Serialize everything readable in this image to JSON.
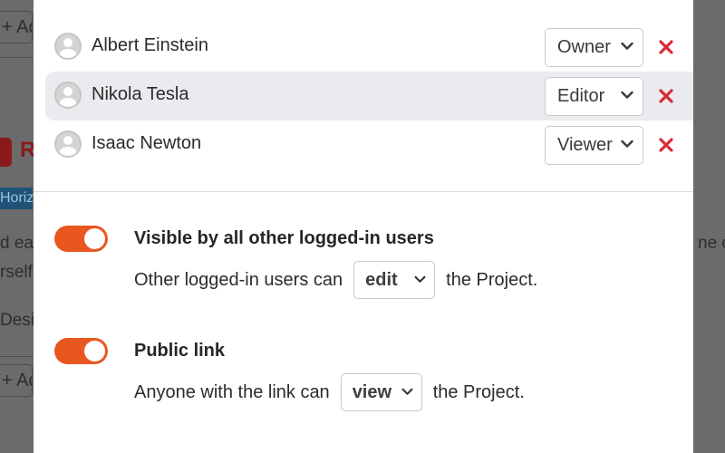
{
  "background": {
    "add_label_1": "+ Add",
    "red_heading": "R",
    "tag_text": "Horizon",
    "text_line_1": "d eac",
    "text_line_2": "rself",
    "text_line_3": "Desi",
    "add_label_2": "+ Add",
    "right_text": "ne c"
  },
  "members": [
    {
      "name": "Albert Einstein",
      "role": "Owner"
    },
    {
      "name": "Nikola Tesla",
      "role": "Editor"
    },
    {
      "name": "Isaac Newton",
      "role": "Viewer"
    }
  ],
  "settings": {
    "visibility": {
      "title": "Visible by all other logged-in users",
      "prefix": "Other logged-in users can",
      "permission": "edit",
      "suffix": "the Project.",
      "enabled": true
    },
    "public_link": {
      "title": "Public link",
      "prefix": "Anyone with the link can",
      "permission": "view",
      "suffix": "the Project.",
      "enabled": true
    }
  },
  "colors": {
    "toggle_on": "#e8571f",
    "remove": "#d92b3a",
    "row_highlight": "#e9ebee"
  },
  "icons": {
    "avatar": "user-avatar-icon",
    "remove": "close-icon",
    "dropdown": "chevron-down-icon"
  }
}
